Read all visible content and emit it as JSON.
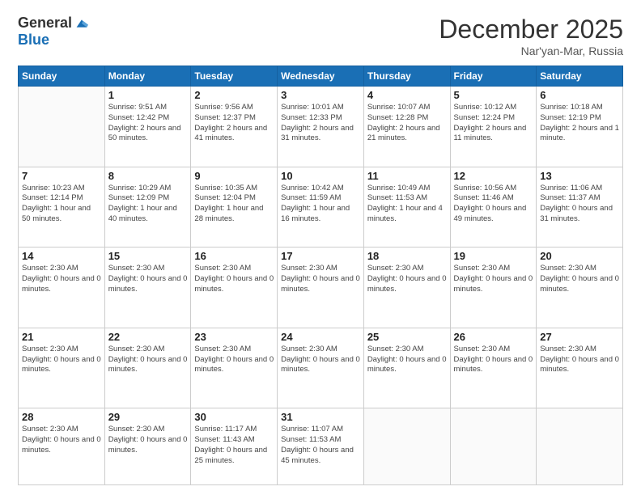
{
  "logo": {
    "general": "General",
    "blue": "Blue"
  },
  "title": "December 2025",
  "location": "Nar'yan-Mar, Russia",
  "weekdays": [
    "Sunday",
    "Monday",
    "Tuesday",
    "Wednesday",
    "Thursday",
    "Friday",
    "Saturday"
  ],
  "weeks": [
    [
      {
        "day": "",
        "info": ""
      },
      {
        "day": "1",
        "info": "Sunrise: 9:51 AM\nSunset: 12:42 PM\nDaylight: 2 hours\nand 50 minutes."
      },
      {
        "day": "2",
        "info": "Sunrise: 9:56 AM\nSunset: 12:37 PM\nDaylight: 2 hours\nand 41 minutes."
      },
      {
        "day": "3",
        "info": "Sunrise: 10:01 AM\nSunset: 12:33 PM\nDaylight: 2 hours\nand 31 minutes."
      },
      {
        "day": "4",
        "info": "Sunrise: 10:07 AM\nSunset: 12:28 PM\nDaylight: 2 hours\nand 21 minutes."
      },
      {
        "day": "5",
        "info": "Sunrise: 10:12 AM\nSunset: 12:24 PM\nDaylight: 2 hours\nand 11 minutes."
      },
      {
        "day": "6",
        "info": "Sunrise: 10:18 AM\nSunset: 12:19 PM\nDaylight: 2 hours\nand 1 minute."
      }
    ],
    [
      {
        "day": "7",
        "info": "Sunrise: 10:23 AM\nSunset: 12:14 PM\nDaylight: 1 hour and\n50 minutes."
      },
      {
        "day": "8",
        "info": "Sunrise: 10:29 AM\nSunset: 12:09 PM\nDaylight: 1 hour and\n40 minutes."
      },
      {
        "day": "9",
        "info": "Sunrise: 10:35 AM\nSunset: 12:04 PM\nDaylight: 1 hour and\n28 minutes."
      },
      {
        "day": "10",
        "info": "Sunrise: 10:42 AM\nSunset: 11:59 AM\nDaylight: 1 hour and\n16 minutes."
      },
      {
        "day": "11",
        "info": "Sunrise: 10:49 AM\nSunset: 11:53 AM\nDaylight: 1 hour and\n4 minutes."
      },
      {
        "day": "12",
        "info": "Sunrise: 10:56 AM\nSunset: 11:46 AM\nDaylight: 0 hours\nand 49 minutes."
      },
      {
        "day": "13",
        "info": "Sunrise: 11:06 AM\nSunset: 11:37 AM\nDaylight: 0 hours\nand 31 minutes."
      }
    ],
    [
      {
        "day": "14",
        "info": "Sunset: 2:30 AM\nDaylight: 0 hours\nand 0 minutes."
      },
      {
        "day": "15",
        "info": "Sunset: 2:30 AM\nDaylight: 0 hours\nand 0 minutes."
      },
      {
        "day": "16",
        "info": "Sunset: 2:30 AM\nDaylight: 0 hours\nand 0 minutes."
      },
      {
        "day": "17",
        "info": "Sunset: 2:30 AM\nDaylight: 0 hours\nand 0 minutes."
      },
      {
        "day": "18",
        "info": "Sunset: 2:30 AM\nDaylight: 0 hours\nand 0 minutes."
      },
      {
        "day": "19",
        "info": "Sunset: 2:30 AM\nDaylight: 0 hours\nand 0 minutes."
      },
      {
        "day": "20",
        "info": "Sunset: 2:30 AM\nDaylight: 0 hours\nand 0 minutes."
      }
    ],
    [
      {
        "day": "21",
        "info": "Sunset: 2:30 AM\nDaylight: 0 hours\nand 0 minutes."
      },
      {
        "day": "22",
        "info": "Sunset: 2:30 AM\nDaylight: 0 hours\nand 0 minutes."
      },
      {
        "day": "23",
        "info": "Sunset: 2:30 AM\nDaylight: 0 hours\nand 0 minutes."
      },
      {
        "day": "24",
        "info": "Sunset: 2:30 AM\nDaylight: 0 hours\nand 0 minutes."
      },
      {
        "day": "25",
        "info": "Sunset: 2:30 AM\nDaylight: 0 hours\nand 0 minutes."
      },
      {
        "day": "26",
        "info": "Sunset: 2:30 AM\nDaylight: 0 hours\nand 0 minutes."
      },
      {
        "day": "27",
        "info": "Sunset: 2:30 AM\nDaylight: 0 hours\nand 0 minutes."
      }
    ],
    [
      {
        "day": "28",
        "info": "Sunset: 2:30 AM\nDaylight: 0 hours\nand 0 minutes."
      },
      {
        "day": "29",
        "info": "Sunset: 2:30 AM\nDaylight: 0 hours\nand 0 minutes."
      },
      {
        "day": "30",
        "info": "Sunrise: 11:17 AM\nSunset: 11:43 AM\nDaylight: 0 hours\nand 25 minutes."
      },
      {
        "day": "31",
        "info": "Sunrise: 11:07 AM\nSunset: 11:53 AM\nDaylight: 0 hours\nand 45 minutes."
      },
      {
        "day": "",
        "info": ""
      },
      {
        "day": "",
        "info": ""
      },
      {
        "day": "",
        "info": ""
      }
    ]
  ]
}
